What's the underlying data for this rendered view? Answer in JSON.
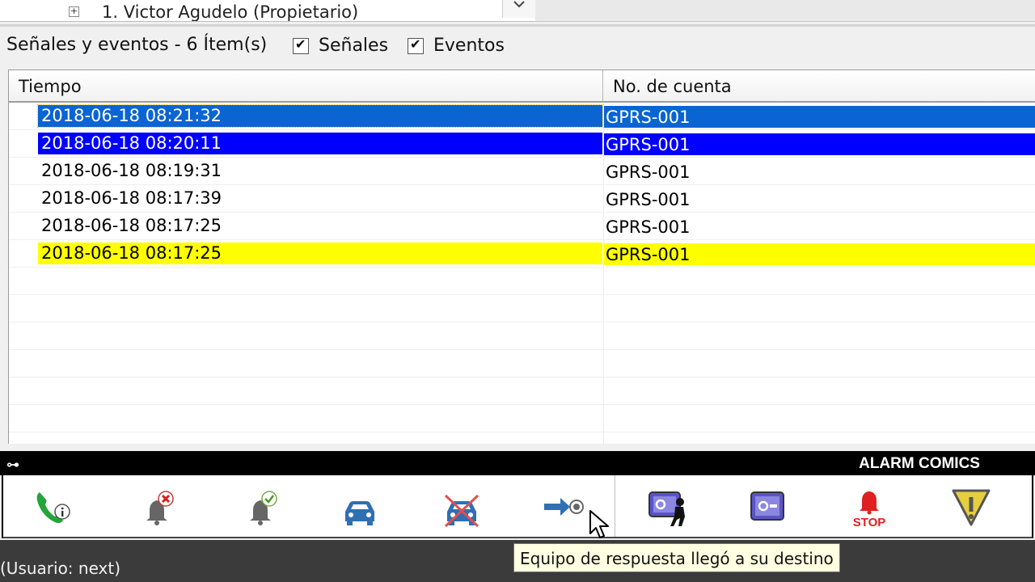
{
  "tree": {
    "node_label": "1. Victor Agudelo (Propietario)",
    "expander": "+"
  },
  "panel": {
    "title": "Señales y eventos - 6 Ítem(s)",
    "checkbox_signals": "Señales",
    "checkbox_events": "Eventos"
  },
  "grid": {
    "columns": [
      "Tiempo",
      "No. de cuenta"
    ],
    "rows": [
      {
        "time": "2018-06-18 08:21:32",
        "account": "GPRS-001",
        "highlight": "#0a64d2"
      },
      {
        "time": "2018-06-18 08:20:11",
        "account": "GPRS-001",
        "highlight": "#0000ff"
      },
      {
        "time": "2018-06-18 08:19:31",
        "account": "GPRS-001",
        "highlight": ""
      },
      {
        "time": "2018-06-18 08:17:39",
        "account": "GPRS-001",
        "highlight": ""
      },
      {
        "time": "2018-06-18 08:17:25",
        "account": "GPRS-001",
        "highlight": ""
      },
      {
        "time": "2018-06-18 08:17:25",
        "account": "GPRS-001",
        "highlight": "#ffff00"
      }
    ]
  },
  "toolbar": {
    "title": "ALARM COMICS",
    "stop_label": "STOP",
    "buttons": [
      "phone-info-icon",
      "bell-cancel-icon",
      "bell-check-icon",
      "patrol-car-icon",
      "patrol-car-cancel-icon",
      "arrow-target-icon",
      "panel-intruder-icon",
      "alarm-panel-icon",
      "stop-bell-icon",
      "warning-icon"
    ]
  },
  "status": {
    "text": "(Usuario: next)"
  },
  "tooltip": {
    "text": "Equipo de respuesta llegó a su destino"
  },
  "colors": {
    "selected_row": "#0a64d2",
    "blue_row": "#0000ff",
    "yellow_row": "#ffff00",
    "toolbar_icon_blue": "#2f6fb3",
    "stop_red": "#e02020"
  }
}
